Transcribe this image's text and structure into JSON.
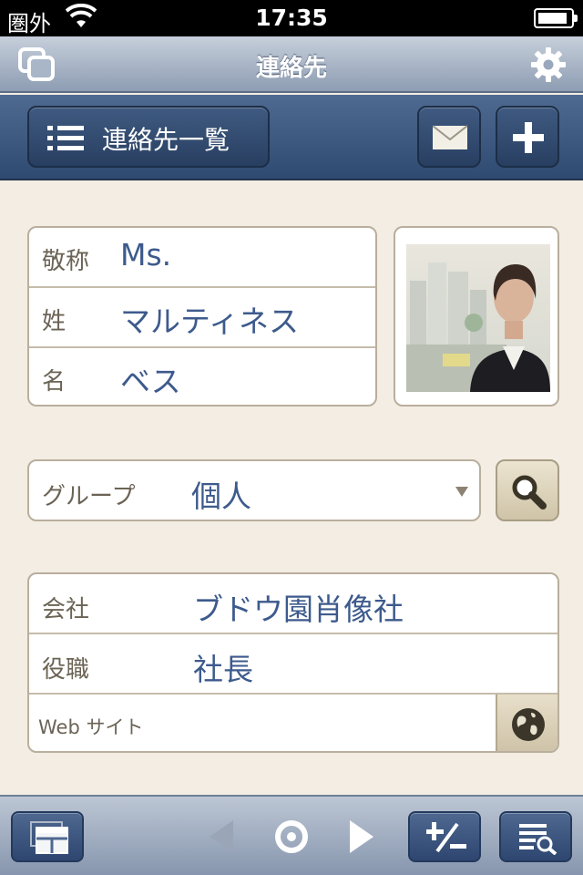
{
  "status_bar": {
    "carrier": "圏外",
    "time": "17:35"
  },
  "nav_bar": {
    "title": "連絡先",
    "left_icon": "layers-icon",
    "right_icon": "gear-icon"
  },
  "toolbar": {
    "list_label": "連絡先一覧",
    "list_icon": "list-icon",
    "mail_icon": "mail-icon",
    "add_icon": "plus-icon"
  },
  "name_fields": [
    {
      "label": "敬称",
      "value": "Ms."
    },
    {
      "label": "姓",
      "value": "マルティネス"
    },
    {
      "label": "名",
      "value": "ベス"
    }
  ],
  "group": {
    "label": "グループ",
    "value": "個人"
  },
  "company_fields": [
    {
      "label": "会社",
      "value": "ブドウ園肖像社"
    },
    {
      "label": "役職",
      "value": "社長"
    },
    {
      "label": "Web サイト",
      "value": ""
    }
  ],
  "bottom_bar": {
    "icons": [
      "layout-icon",
      "prev-arrow-icon",
      "record-icon",
      "next-arrow-icon",
      "plus-minus-icon",
      "find-icon"
    ]
  },
  "colors": {
    "accent_value": "#3d5a8c",
    "toolbar_dark": "#2f4a70",
    "background": "#f3ede3"
  }
}
